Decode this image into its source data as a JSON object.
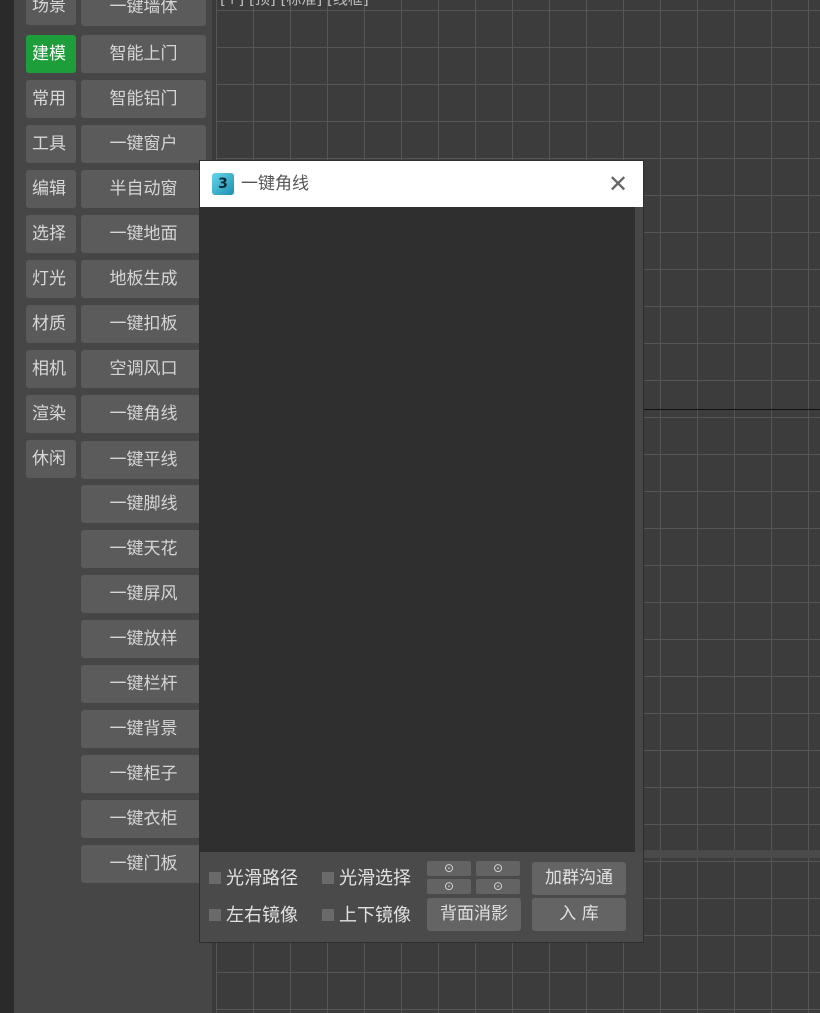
{
  "viewport": {
    "header": "[+] [顶] [标准] [线框]"
  },
  "categories": [
    {
      "label": "场景"
    },
    {
      "label": "建模"
    },
    {
      "label": "常用"
    },
    {
      "label": "工具"
    },
    {
      "label": "编辑"
    },
    {
      "label": "选择"
    },
    {
      "label": "灯光"
    },
    {
      "label": "材质"
    },
    {
      "label": "相机"
    },
    {
      "label": "渲染"
    },
    {
      "label": "休闲"
    }
  ],
  "active_category": "建模",
  "actions": [
    {
      "label": "一键墙体"
    },
    {
      "label": "智能上门"
    },
    {
      "label": "智能铝门"
    },
    {
      "label": "一键窗户"
    },
    {
      "label": "半自动窗"
    },
    {
      "label": "一键地面"
    },
    {
      "label": "地板生成"
    },
    {
      "label": "一键扣板"
    },
    {
      "label": "空调风口"
    },
    {
      "label": "一键角线"
    },
    {
      "label": "一键平线"
    },
    {
      "label": "一键脚线"
    },
    {
      "label": "一键天花"
    },
    {
      "label": "一键屏风"
    },
    {
      "label": "一键放样"
    },
    {
      "label": "一键栏杆"
    },
    {
      "label": "一键背景"
    },
    {
      "label": "一键柜子"
    },
    {
      "label": "一键衣柜"
    },
    {
      "label": "一键门板"
    }
  ],
  "dialog": {
    "app_icon_text": "3",
    "title": "一键角线",
    "close_glyph": "✕",
    "checkboxes": [
      {
        "label": "光滑路径"
      },
      {
        "label": "光滑选择"
      },
      {
        "label": "左右镜像"
      },
      {
        "label": "上下镜像"
      }
    ],
    "radio_glyph": "⊙",
    "buttons": {
      "join_group": "加群沟通",
      "backface_cull": "背面消影",
      "add_library": "入 库"
    }
  },
  "colors": {
    "active_category": "#1e9e3a",
    "panel_bg": "#464646",
    "button_bg": "#5b5b5b",
    "dialog_content": "#2f2f2f",
    "viewport_bg": "#3c3c3c"
  }
}
